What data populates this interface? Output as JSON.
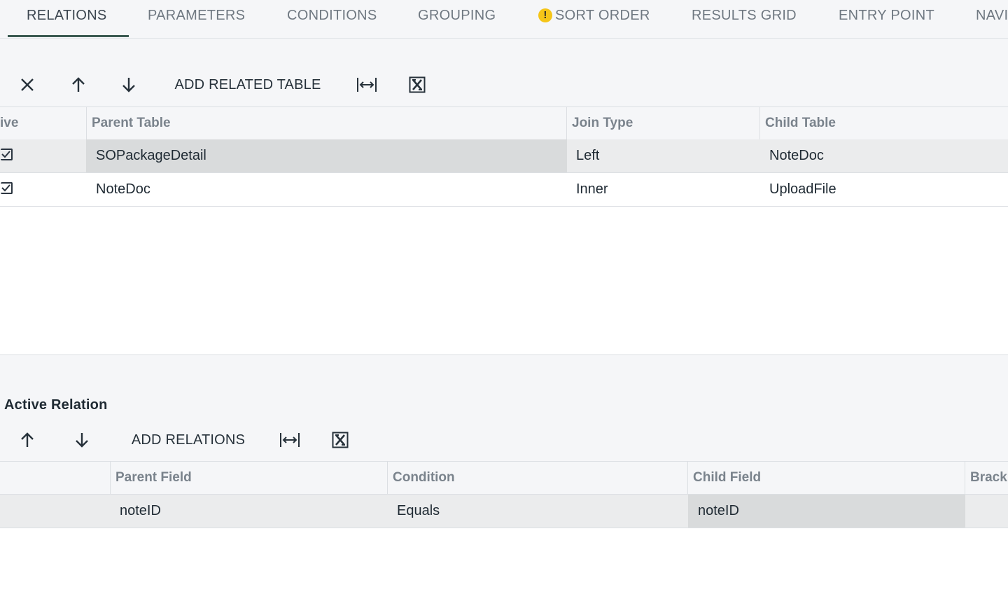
{
  "tabs": [
    {
      "label": "RELATIONS",
      "active": true
    },
    {
      "label": "PARAMETERS"
    },
    {
      "label": "CONDITIONS"
    },
    {
      "label": "GROUPING"
    },
    {
      "label": "SORT ORDER",
      "warning": "!"
    },
    {
      "label": "RESULTS GRID"
    },
    {
      "label": "ENTRY POINT"
    },
    {
      "label": "NAVI"
    }
  ],
  "relations_toolbar": {
    "delete_icon": "close-icon",
    "up_icon": "arrow-up-icon",
    "down_icon": "arrow-down-icon",
    "add_label": "ADD RELATED TABLE",
    "fit_icon": "fit-width-icon",
    "export_icon": "export-excel-icon"
  },
  "relations_grid": {
    "columns": [
      "ive",
      "Parent Table",
      "Join Type",
      "Child Table"
    ],
    "rows": [
      {
        "active": true,
        "parent_table": "SOPackageDetail",
        "join_type": "Left",
        "child_table": "NoteDoc"
      },
      {
        "active": true,
        "parent_table": "NoteDoc",
        "join_type": "Inner",
        "child_table": "UploadFile"
      }
    ]
  },
  "active_relation": {
    "title": "Active Relation",
    "toolbar": {
      "up_icon": "arrow-up-icon",
      "down_icon": "arrow-down-icon",
      "add_label": "ADD RELATIONS",
      "fit_icon": "fit-width-icon",
      "export_icon": "export-excel-icon"
    },
    "columns": [
      "Parent Field",
      "Condition",
      "Child Field",
      "Brack"
    ],
    "rows": [
      {
        "parent_field": "noteID",
        "condition": "Equals",
        "child_field": "noteID"
      }
    ]
  },
  "colors": {
    "accent": "#3b5a52",
    "warning": "#f5c518",
    "header_bg": "#f5f6f8",
    "selected_row": "#ebeced"
  }
}
